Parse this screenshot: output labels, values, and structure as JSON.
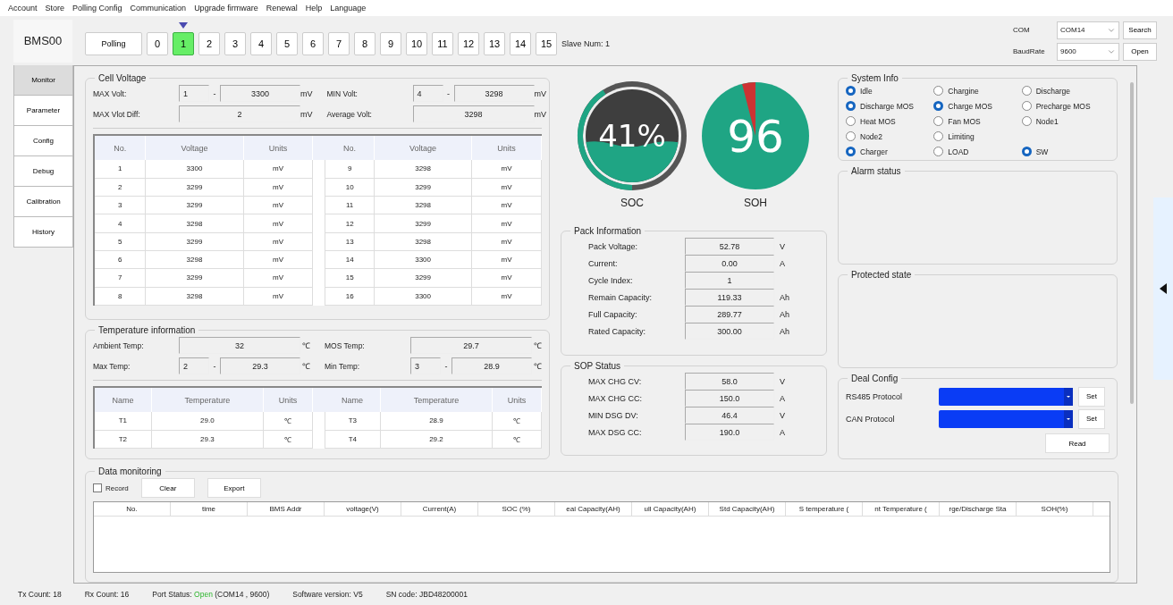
{
  "menu": [
    "Account",
    "Store",
    "Polling Config",
    "Communication",
    "Upgrade firmware",
    "Renewal",
    "Help",
    "Language"
  ],
  "logo": "BMS00",
  "polling": {
    "label": "Polling",
    "slaves": [
      {
        "label": "0",
        "selected": false
      },
      {
        "label": "1",
        "selected": true
      },
      {
        "label": "2",
        "selected": false
      },
      {
        "label": "3",
        "selected": false
      },
      {
        "label": "4",
        "selected": false
      },
      {
        "label": "5",
        "selected": false
      },
      {
        "label": "6",
        "selected": false
      },
      {
        "label": "7",
        "selected": false
      },
      {
        "label": "8",
        "selected": false
      },
      {
        "label": "9",
        "selected": false
      },
      {
        "label": "10",
        "selected": false
      },
      {
        "label": "11",
        "selected": false
      },
      {
        "label": "12",
        "selected": false
      },
      {
        "label": "13",
        "selected": false
      },
      {
        "label": "14",
        "selected": false
      },
      {
        "label": "15",
        "selected": false
      }
    ],
    "slave_num": "Slave Num: 1"
  },
  "connection": {
    "com_label": "COM",
    "com_value": "COM14",
    "search": "Search",
    "baud_label": "BaudRate",
    "baud_value": "9600",
    "open": "Open"
  },
  "sidebar": [
    {
      "label": "Monitor",
      "selected": true
    },
    {
      "label": "Parameter",
      "selected": false
    },
    {
      "label": "Config",
      "selected": false
    },
    {
      "label": "Debug",
      "selected": false
    },
    {
      "label": "Calibration",
      "selected": false
    },
    {
      "label": "History",
      "selected": false
    }
  ],
  "cell_voltage": {
    "title": "Cell Voltage",
    "fields": [
      {
        "label": "MAX Volt:",
        "index": "1",
        "separator": "-",
        "value": "3300",
        "unit": "mV"
      },
      {
        "label": "MIN Volt:",
        "index": "4",
        "separator": "-",
        "value": "3298",
        "unit": "mV"
      },
      {
        "label": "MAX Vlot Diff:",
        "value": "2",
        "unit": "mV"
      },
      {
        "label": "Average  Volt:",
        "value": "3298",
        "unit": "mV"
      }
    ],
    "columns": [
      "No.",
      "Voltage",
      "Units",
      "No.",
      "Voltage",
      "Units"
    ],
    "rows": [
      [
        "1",
        "3300",
        "mV",
        "9",
        "3298",
        "mV"
      ],
      [
        "2",
        "3299",
        "mV",
        "10",
        "3299",
        "mV"
      ],
      [
        "3",
        "3299",
        "mV",
        "11",
        "3298",
        "mV"
      ],
      [
        "4",
        "3298",
        "mV",
        "12",
        "3299",
        "mV"
      ],
      [
        "5",
        "3299",
        "mV",
        "13",
        "3298",
        "mV"
      ],
      [
        "6",
        "3298",
        "mV",
        "14",
        "3300",
        "mV"
      ],
      [
        "7",
        "3299",
        "mV",
        "15",
        "3299",
        "mV"
      ],
      [
        "8",
        "3298",
        "mV",
        "16",
        "3300",
        "mV"
      ]
    ]
  },
  "temperature": {
    "title": "Temperature information",
    "fields": [
      {
        "label": "Ambient Temp:",
        "value": "32",
        "unit": "℃"
      },
      {
        "label": "MOS Temp:",
        "value": "29.7",
        "unit": "℃"
      },
      {
        "label": "Max Temp:",
        "index": "2",
        "separator": "-",
        "value": "29.3",
        "unit": "℃"
      },
      {
        "label": "Min Temp:",
        "index": "3",
        "separator": "-",
        "value": "28.9",
        "unit": "℃"
      }
    ],
    "columns": [
      "Name",
      "Temperature",
      "Units",
      "Name",
      "Temperature",
      "Units"
    ],
    "rows": [
      [
        "T1",
        "29.0",
        "℃",
        "T3",
        "28.9",
        "℃"
      ],
      [
        "T2",
        "29.3",
        "℃",
        "T4",
        "29.2",
        "℃"
      ]
    ]
  },
  "soc": {
    "text": "41%",
    "label": "SOC"
  },
  "soh": {
    "text": "96",
    "label": "SOH"
  },
  "pack_info": {
    "title": "Pack Information",
    "rows": [
      {
        "label": "Pack Voltage:",
        "value": "52.78",
        "unit": "V"
      },
      {
        "label": "Current:",
        "value": "0.00",
        "unit": "A"
      },
      {
        "label": "Cycle Index:",
        "value": "1"
      },
      {
        "label": "Remain Capacity:",
        "value": "119.33",
        "unit": "Ah"
      },
      {
        "label": "Full Capacity:",
        "value": "289.77",
        "unit": "Ah"
      },
      {
        "label": "Rated Capacity:",
        "value": "300.00",
        "unit": "Ah"
      }
    ]
  },
  "sop_status": {
    "title": "SOP Status",
    "rows": [
      {
        "label": "MAX CHG CV:",
        "value": "58.0",
        "unit": "V"
      },
      {
        "label": "MAX CHG CC:",
        "value": "150.0",
        "unit": "A"
      },
      {
        "label": "MIN DSG DV:",
        "value": "46.4",
        "unit": "V"
      },
      {
        "label": "MAX DSG CC:",
        "value": "190.0",
        "unit": "A"
      }
    ]
  },
  "system_info": {
    "title": "System Info",
    "rows": [
      [
        {
          "label": "Idle",
          "checked": true
        },
        {
          "label": "Chargine",
          "checked": false
        },
        {
          "label": "Discharge",
          "checked": false
        }
      ],
      [
        {
          "label": "Discharge MOS",
          "checked": true
        },
        {
          "label": "Charge MOS",
          "checked": true
        },
        {
          "label": "Precharge MOS",
          "checked": false
        }
      ],
      [
        {
          "label": "Heat MOS",
          "checked": false
        },
        {
          "label": "Fan MOS",
          "checked": false
        },
        {
          "label": "Node1",
          "checked": false
        }
      ],
      [
        {
          "label": "Node2",
          "checked": false
        },
        {
          "label": "Limiting",
          "checked": false
        }
      ],
      [
        {
          "label": "Charger",
          "checked": true
        },
        {
          "label": "LOAD",
          "checked": false
        },
        {
          "label": "SW",
          "checked": true
        }
      ]
    ]
  },
  "alarm_status": {
    "title": "Alarm status"
  },
  "protected_state": {
    "title": "Protected state"
  },
  "deal_config": {
    "title": "Deal Config",
    "protocols": [
      {
        "label": "RS485 Protocol",
        "button": "Set"
      },
      {
        "label": "CAN Protocol",
        "button": "Set"
      }
    ],
    "read": "Read"
  },
  "data_monitoring": {
    "title": "Data monitoring",
    "record": {
      "label": "Record",
      "checked": false
    },
    "buttons": [
      "Clear",
      "Export"
    ],
    "columns": [
      "No.",
      "time",
      "BMS Addr",
      "voltage(V)",
      "Current(A)",
      "SOC (%)",
      "eal Capacity(AH)",
      "ull Capacity(AH)",
      "Std Capacity(AH)",
      "S temperature (",
      "nt Temperature (",
      "rge/Discharge Sta",
      "SOH(%)"
    ]
  },
  "status_bar": {
    "tx": "Tx Count: 18",
    "rx": "Rx Count: 16",
    "port_label": "Port Status:",
    "port_state": "Open",
    "port_detail": "(COM14 , 9600)",
    "software": "Software version: V5",
    "sn": "SN code: JBD48200001"
  }
}
